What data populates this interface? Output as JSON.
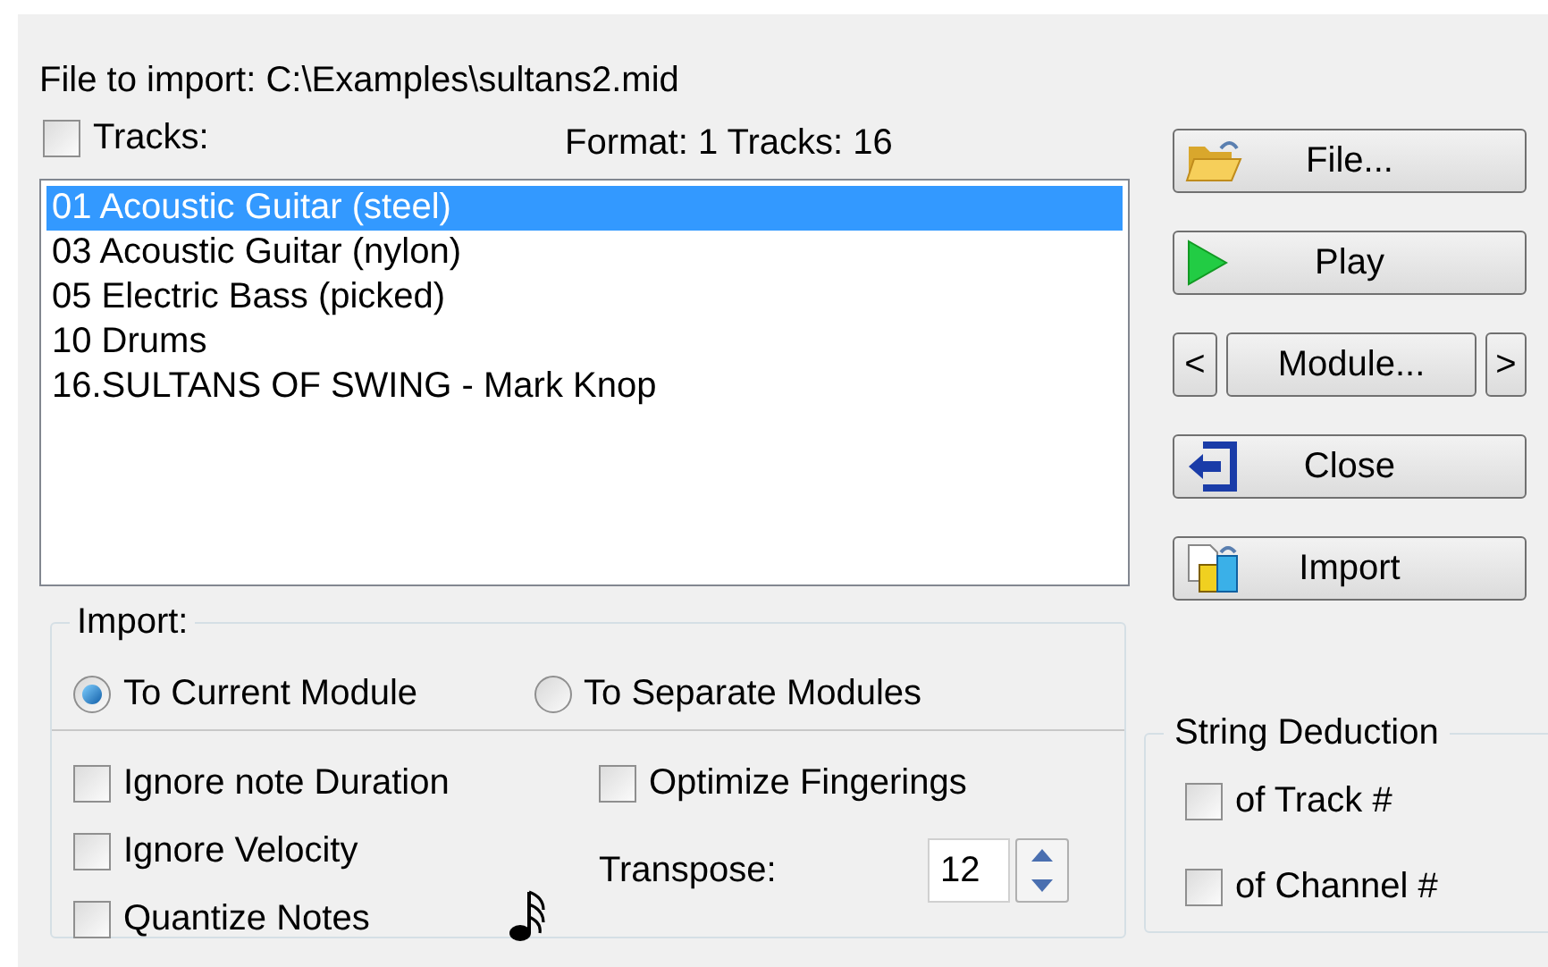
{
  "file_label": "File to import: C:\\Examples\\sultans2.mid",
  "tracks_checkbox": {
    "label": "Tracks:",
    "checked": false
  },
  "format_info": "Format: 1 Tracks: 16",
  "tracks": [
    {
      "label": "01 Acoustic Guitar (steel)",
      "selected": true
    },
    {
      "label": "03 Acoustic Guitar (nylon)",
      "selected": false
    },
    {
      "label": "05 Electric Bass (picked)",
      "selected": false
    },
    {
      "label": "10 Drums",
      "selected": false
    },
    {
      "label": "16.SULTANS OF SWING - Mark Knop",
      "selected": false
    }
  ],
  "buttons": [
    {
      "kind": "file",
      "label": "File..."
    },
    {
      "kind": "play",
      "label": "Play"
    },
    {
      "kind": "module",
      "label": "Module...",
      "prev": "<",
      "next": ">"
    },
    {
      "kind": "close",
      "label": "Close"
    },
    {
      "kind": "import",
      "label": "Import"
    }
  ],
  "import_group": {
    "title": "Import:",
    "targets": [
      {
        "label": "To Current Module",
        "selected": true
      },
      {
        "label": "To Separate Modules",
        "selected": false
      }
    ],
    "options": [
      {
        "label": "Ignore note Duration",
        "checked": false
      },
      {
        "label": "Ignore Velocity",
        "checked": false
      },
      {
        "label": "Quantize Notes",
        "checked": false
      }
    ],
    "optimize": {
      "label": "Optimize Fingerings",
      "checked": false
    },
    "transpose": {
      "label": "Transpose:",
      "value": "12"
    }
  },
  "string_deduction": {
    "title": "String Deduction",
    "options": [
      {
        "label": "of Track #",
        "checked": false
      },
      {
        "label": "of Channel #",
        "checked": false
      }
    ]
  }
}
